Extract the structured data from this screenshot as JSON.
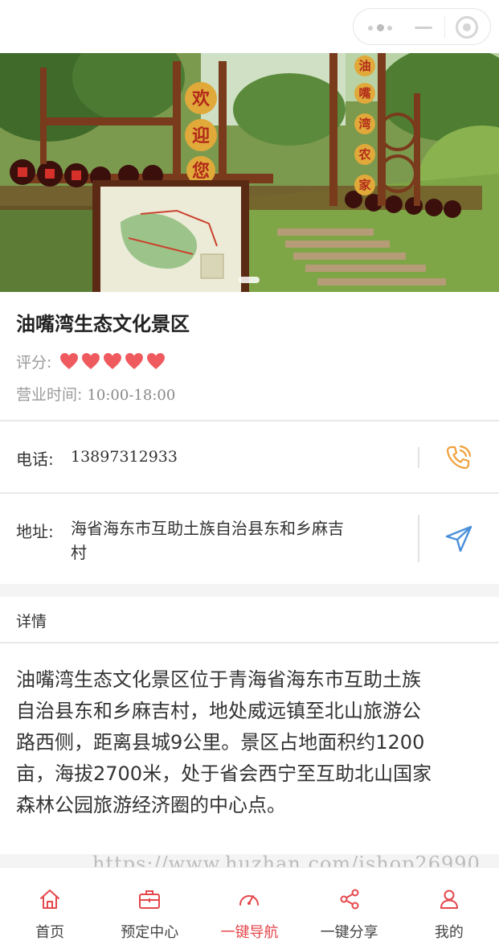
{
  "place": {
    "title": "油嘴湾生态文化景区",
    "rating_label": "评分:",
    "rating_value": 5,
    "rating_max": 5,
    "hours_label": "营业时间:",
    "hours_value": "10:00-18:00"
  },
  "contact": {
    "phone_label": "电话:",
    "phone_value": "13897312933",
    "address_label": "地址:",
    "address_line1": "海省海东市互助土族自治县东和乡麻吉",
    "address_line2": "村"
  },
  "detail": {
    "label": "详情",
    "text_lines": [
      "油嘴湾生态文化景区位于青海省海东市互助土族",
      "自治县东和乡麻吉村，地处威远镇至北山旅游公",
      "路西侧，距离县城9公里。景区占地面积约1200",
      "亩，海拔2700米，处于省会西宁至互助北山国家",
      "森林公园旅游经济圈的中心点。"
    ]
  },
  "hero": {
    "sign_text": [
      "欢",
      "迎",
      "您"
    ],
    "tower_text": [
      "油",
      "嘴",
      "湾",
      "农",
      "家"
    ],
    "slide_index": 1,
    "slide_count": 1
  },
  "watermark": "https://www.huzhan.com/ishop26990",
  "tabs": [
    {
      "label": "首页",
      "icon": "home-icon",
      "active": false
    },
    {
      "label": "预定中心",
      "icon": "briefcase-icon",
      "active": false
    },
    {
      "label": "一键导航",
      "icon": "gauge-icon",
      "active": true
    },
    {
      "label": "一键分享",
      "icon": "share-icon",
      "active": false
    },
    {
      "label": "我的",
      "icon": "user-icon",
      "active": false
    }
  ],
  "colors": {
    "accent": "#e4474b",
    "heart": "#ef5a5f",
    "phone_icon": "#f0a03a",
    "nav_icon": "#4a90d9",
    "muted": "#9a9a9a"
  }
}
